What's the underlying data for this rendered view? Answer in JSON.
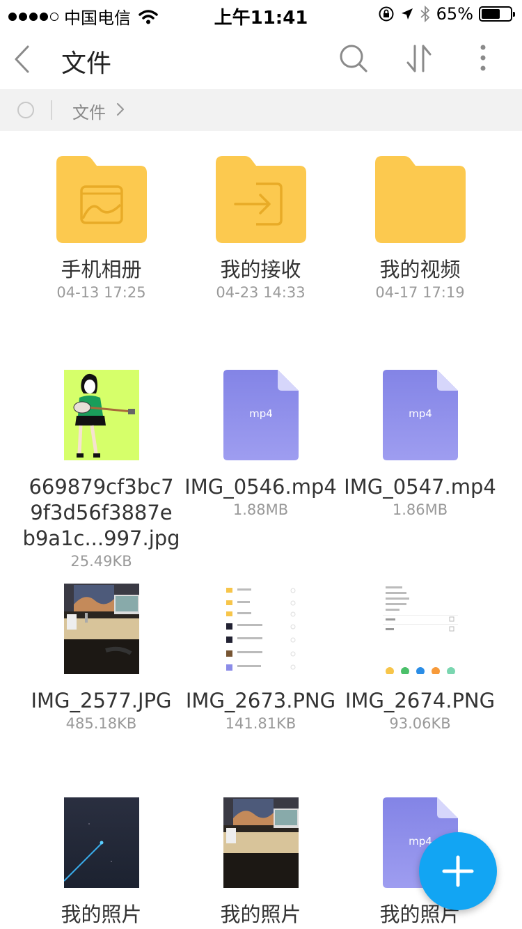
{
  "status_bar": {
    "carrier": "中国电信",
    "time": "上午11:41",
    "battery_percent": "65%",
    "battery_level": 0.65
  },
  "nav": {
    "title": "文件",
    "back_icon": "chevron-left-icon",
    "search_icon": "search-icon",
    "sort_icon": "sort-icon",
    "more_icon": "more-vertical-icon"
  },
  "breadcrumb": {
    "current": "文件"
  },
  "folders": [
    {
      "name": "手机相册",
      "date": "04-13 17:25",
      "icon": "image-icon"
    },
    {
      "name": "我的接收",
      "date": "04-23 14:33",
      "icon": "receive-icon"
    },
    {
      "name": "我的视频",
      "date": "04-17 17:19",
      "icon": ""
    }
  ],
  "files_row1": [
    {
      "name_lines": [
        "669879cf3bc7",
        "9f3d56f3887e",
        "b9a1c...997.jpg"
      ],
      "size": "25.49KB",
      "type": "image"
    },
    {
      "name": "IMG_0546.mp4",
      "size": "1.88MB",
      "type": "mp4",
      "label": "mp4"
    },
    {
      "name": "IMG_0547.mp4",
      "size": "1.86MB",
      "type": "mp4",
      "label": "mp4"
    }
  ],
  "files_row2": [
    {
      "name": "IMG_2577.JPG",
      "size": "485.18KB"
    },
    {
      "name": "IMG_2673.PNG",
      "size": "141.81KB"
    },
    {
      "name": "IMG_2674.PNG",
      "size": "93.06KB"
    }
  ],
  "files_row3": [
    {
      "name": "我的照片"
    },
    {
      "name": "我的照片"
    },
    {
      "name": "我的照片",
      "label": "mp4"
    }
  ],
  "fab": {
    "icon": "plus-icon"
  },
  "colors": {
    "folder": "#fcc94f",
    "folder_glyph": "#e8ab27",
    "doc": "#8b8ce8",
    "fab": "#12a5f3"
  }
}
